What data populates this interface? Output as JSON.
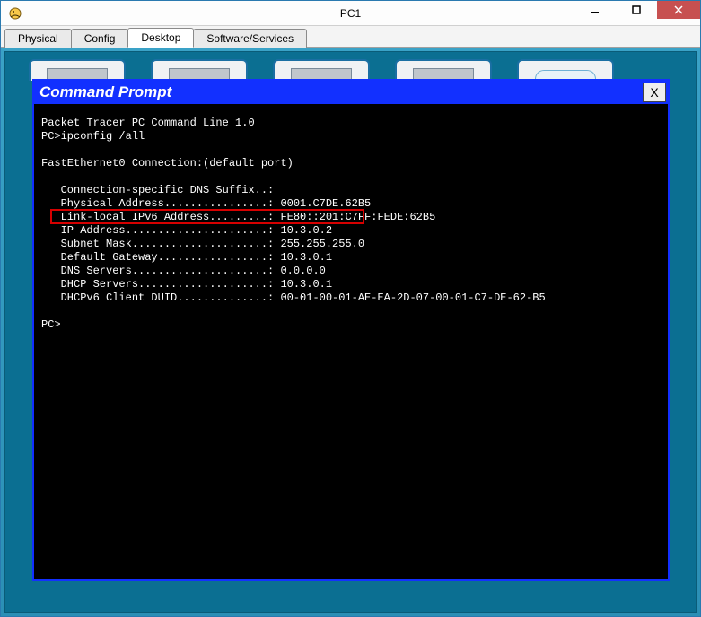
{
  "window": {
    "title": "PC1"
  },
  "tabs": {
    "physical": "Physical",
    "config": "Config",
    "desktop": "Desktop",
    "software": "Software/Services"
  },
  "cmd": {
    "title": "Command Prompt",
    "close_label": "X",
    "line_banner": "Packet Tracer PC Command Line 1.0",
    "line_cmd": "PC>ipconfig /all",
    "line_iface": "FastEthernet0 Connection:(default port)",
    "line_dns_suffix": "   Connection-specific DNS Suffix..: ",
    "line_phys_addr": "   Physical Address................: 0001.C7DE.62B5",
    "line_linklocal": "   Link-local IPv6 Address.........: FE80::201:C7FF:FEDE:62B5",
    "line_ip": "   IP Address......................: 10.3.0.2",
    "line_subnet": "   Subnet Mask.....................: 255.255.255.0",
    "line_gateway": "   Default Gateway.................: 10.3.0.1",
    "line_dns": "   DNS Servers.....................: 0.0.0.0",
    "line_dhcp": "   DHCP Servers....................: 10.3.0.1",
    "line_duid": "   DHCPv6 Client DUID..............: 00-01-00-01-AE-EA-2D-07-00-01-C7-DE-62-B5",
    "line_prompt": "PC>"
  },
  "highlight": {
    "target": "physical-address-line"
  }
}
